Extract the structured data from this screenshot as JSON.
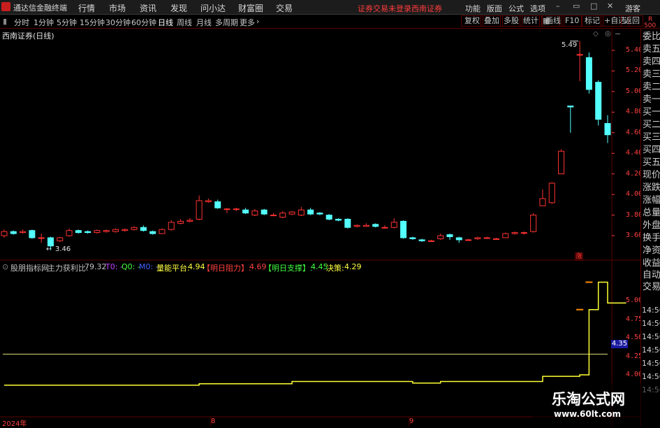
{
  "menubar": {
    "title": "通达信金融终端",
    "items": [
      "行情",
      "市场",
      "资讯",
      "发现",
      "问小达",
      "财富圈",
      "交易"
    ],
    "login_status": "证券交易未登录",
    "broker": "西南证券",
    "right_items": [
      "功能",
      "版面",
      "公式",
      "选项"
    ],
    "guest": "游客"
  },
  "periodbar": {
    "periods": [
      "分时",
      "1分钟",
      "5分钟",
      "15分钟",
      "30分钟",
      "60分钟",
      "日线",
      "周线",
      "月线",
      "多周期",
      "更多"
    ],
    "active": "日线",
    "right_tools": [
      "复权",
      "叠加",
      "多股",
      "统计",
      "画线",
      "F10",
      "标记",
      "+自选",
      "返回"
    ]
  },
  "chart_header": {
    "stock_title": "西南证券(日线)"
  },
  "indicator_header": {
    "name": "股朋指标网",
    "profit_label": "主力获利比:",
    "profit_value": "79.32",
    "t0": "T0: -",
    "q0": "Q0: -",
    "m0": "M0: -",
    "platform_label": "量能平台:",
    "platform_value": "4.94",
    "resistance_label": "【明日阻力】:",
    "resistance_value": "4.69",
    "support_label": "【明日支撑】:",
    "support_value": "4.45",
    "decision_label": "决策:",
    "decision_value": "4.29"
  },
  "right_panel": {
    "top": [
      "R",
      "500"
    ],
    "labels": [
      "委比",
      "卖五",
      "卖四",
      "卖三",
      "卖二",
      "卖一",
      "买一",
      "买二",
      "买三",
      "买四",
      "买五",
      "现价",
      "涨跌",
      "涨幅",
      "总量",
      "外盘",
      "换手",
      "净资",
      "收益"
    ],
    "lower": [
      "自动",
      "交易"
    ],
    "times": [
      "14:56",
      "14:56",
      "14:56",
      "14:56",
      "14:56",
      "14:56",
      "14:56"
    ]
  },
  "price_axis": [
    "5.40",
    "5.20",
    "5.00",
    "4.80",
    "4.60",
    "4.40",
    "4.20",
    "4.00",
    "3.80",
    "3.60"
  ],
  "indicator_axis": [
    "5.00",
    "4.75",
    "4.50",
    "4.25",
    "4.00"
  ],
  "indicator_axis_highlight": "4.35",
  "high_label": "5.49",
  "low_label": "3.46",
  "limit_up_badge": "涨",
  "time_axis": [
    "2024年",
    "8",
    "9"
  ],
  "watermark": {
    "text": "乐淘公式网",
    "url": "www.60lt.com"
  },
  "colors": {
    "up": "#ff3232",
    "down": "#54ffff",
    "axis": "#ff4040",
    "gridline": "#5a0000",
    "indicator_line": "#ffff33",
    "level_line": "#e0e07a"
  },
  "chart_data": {
    "type": "candlestick",
    "price_range": [
      3.46,
      5.49
    ],
    "candles": [
      [
        3.6,
        3.64,
        3.66,
        3.58
      ],
      [
        3.64,
        3.62,
        3.65,
        3.61
      ],
      [
        3.63,
        3.64,
        3.66,
        3.62
      ],
      [
        3.65,
        3.58,
        3.66,
        3.57
      ],
      [
        3.58,
        3.58,
        3.62,
        3.53
      ],
      [
        3.58,
        3.5,
        3.59,
        3.46
      ],
      [
        3.55,
        3.58,
        3.59,
        3.54
      ],
      [
        3.6,
        3.65,
        3.67,
        3.59
      ],
      [
        3.65,
        3.63,
        3.66,
        3.62
      ],
      [
        3.64,
        3.63,
        3.65,
        3.62
      ],
      [
        3.63,
        3.65,
        3.66,
        3.62
      ],
      [
        3.64,
        3.65,
        3.66,
        3.63
      ],
      [
        3.64,
        3.66,
        3.67,
        3.63
      ],
      [
        3.65,
        3.66,
        3.67,
        3.64
      ],
      [
        3.66,
        3.68,
        3.69,
        3.65
      ],
      [
        3.68,
        3.65,
        3.7,
        3.64
      ],
      [
        3.64,
        3.62,
        3.65,
        3.61
      ],
      [
        3.62,
        3.66,
        3.67,
        3.62
      ],
      [
        3.66,
        3.73,
        3.75,
        3.65
      ],
      [
        3.72,
        3.74,
        3.76,
        3.71
      ],
      [
        3.74,
        3.75,
        3.77,
        3.73
      ],
      [
        3.76,
        3.94,
        3.99,
        3.75
      ],
      [
        3.93,
        3.94,
        3.96,
        3.92
      ],
      [
        3.93,
        3.87,
        3.95,
        3.86
      ],
      [
        3.86,
        3.86,
        3.87,
        3.82
      ],
      [
        3.86,
        3.86,
        3.87,
        3.84
      ],
      [
        3.85,
        3.82,
        3.87,
        3.81
      ],
      [
        3.8,
        3.84,
        3.86,
        3.79
      ],
      [
        3.85,
        3.81,
        3.86,
        3.8
      ],
      [
        3.8,
        3.8,
        3.82,
        3.79
      ],
      [
        3.78,
        3.82,
        3.84,
        3.77
      ],
      [
        3.81,
        3.83,
        3.84,
        3.8
      ],
      [
        3.8,
        3.85,
        3.88,
        3.79
      ],
      [
        3.85,
        3.81,
        3.87,
        3.8
      ],
      [
        3.82,
        3.81,
        3.83,
        3.8
      ],
      [
        3.8,
        3.76,
        3.81,
        3.75
      ],
      [
        3.76,
        3.75,
        3.77,
        3.74
      ],
      [
        3.76,
        3.68,
        3.77,
        3.67
      ],
      [
        3.69,
        3.7,
        3.71,
        3.68
      ],
      [
        3.69,
        3.7,
        3.72,
        3.69
      ],
      [
        3.71,
        3.69,
        3.72,
        3.68
      ],
      [
        3.68,
        3.68,
        3.7,
        3.67
      ],
      [
        3.68,
        3.73,
        3.77,
        3.67
      ],
      [
        3.74,
        3.58,
        3.75,
        3.57
      ],
      [
        3.58,
        3.57,
        3.59,
        3.56
      ],
      [
        3.56,
        3.55,
        3.57,
        3.54
      ],
      [
        3.55,
        3.55,
        3.56,
        3.54
      ],
      [
        3.57,
        3.6,
        3.62,
        3.56
      ],
      [
        3.61,
        3.59,
        3.62,
        3.56
      ],
      [
        3.58,
        3.56,
        3.59,
        3.53
      ],
      [
        3.56,
        3.56,
        3.57,
        3.55
      ],
      [
        3.57,
        3.58,
        3.59,
        3.56
      ],
      [
        3.58,
        3.58,
        3.59,
        3.57
      ],
      [
        3.57,
        3.57,
        3.58,
        3.56
      ],
      [
        3.58,
        3.62,
        3.63,
        3.58
      ],
      [
        3.62,
        3.63,
        3.64,
        3.61
      ],
      [
        3.63,
        3.63,
        3.64,
        3.61
      ],
      [
        3.64,
        3.8,
        3.82,
        3.63
      ],
      [
        3.89,
        3.96,
        4.05,
        3.89
      ],
      [
        3.92,
        4.11,
        4.12,
        3.91
      ],
      [
        4.2,
        4.42,
        4.44,
        4.2
      ],
      [
        4.86,
        4.85,
        4.86,
        4.6
      ],
      [
        5.36,
        5.36,
        5.49,
        5.1
      ],
      [
        5.33,
        5.02,
        5.38,
        4.98
      ],
      [
        5.09,
        4.73,
        5.11,
        4.67
      ],
      [
        4.69,
        4.58,
        4.77,
        4.5
      ]
    ],
    "indicator": {
      "name": "股朋指标网",
      "values": [
        3.86,
        3.86,
        3.86,
        3.86,
        3.86,
        3.86,
        3.86,
        3.86,
        3.86,
        3.86,
        3.86,
        3.86,
        3.86,
        3.86,
        3.86,
        3.86,
        3.86,
        3.86,
        3.86,
        3.86,
        3.86,
        3.88,
        3.88,
        3.88,
        3.88,
        3.88,
        3.88,
        3.88,
        3.88,
        3.88,
        3.88,
        3.91,
        3.91,
        3.91,
        3.91,
        3.91,
        3.91,
        3.91,
        3.91,
        3.91,
        3.91,
        3.91,
        3.91,
        3.91,
        3.89,
        3.89,
        3.89,
        3.91,
        3.91,
        3.91,
        3.91,
        3.91,
        3.91,
        3.91,
        3.91,
        3.91,
        3.91,
        3.91,
        3.98,
        3.98,
        3.98,
        3.98,
        4.0,
        4.88,
        5.25,
        4.97,
        4.97,
        4.97
      ],
      "level_line": 4.28
    }
  }
}
